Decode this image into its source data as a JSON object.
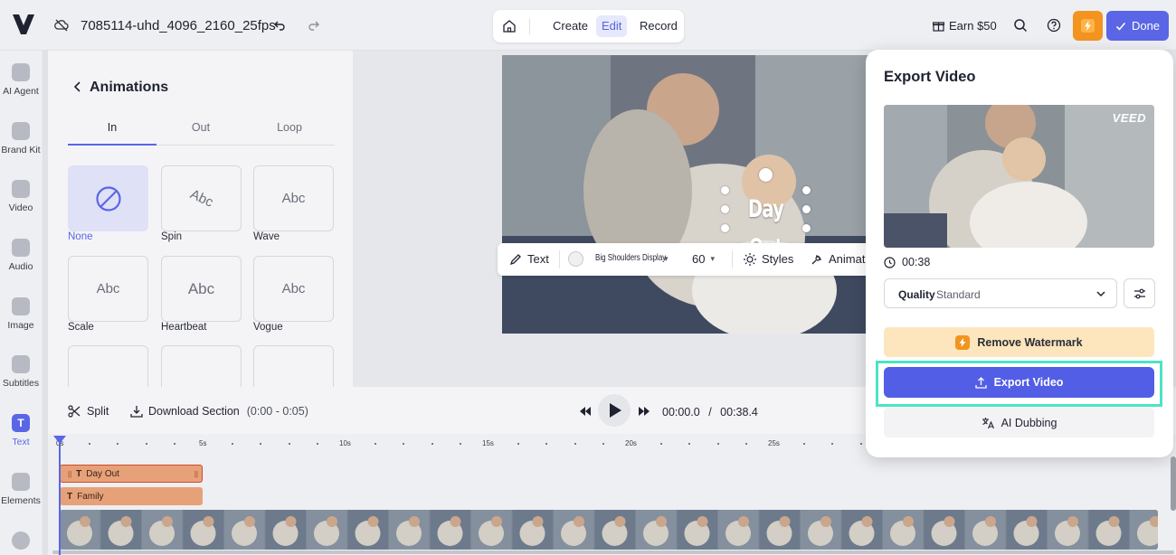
{
  "topbar": {
    "project_title": "7085114-uhd_4096_2160_25fps",
    "modes": {
      "create": "Create",
      "edit": "Edit",
      "record": "Record"
    },
    "earn_label": "Earn $50",
    "done_label": "Done",
    "icons": [
      "veed-logo-icon",
      "cloud-off-icon",
      "undo-icon",
      "redo-icon",
      "home-icon",
      "gift-icon",
      "search-icon",
      "help-icon",
      "bolt-icon",
      "check-icon"
    ]
  },
  "sidebar": {
    "items": [
      {
        "label": "AI Agent",
        "icon": "ai-agent-icon"
      },
      {
        "label": "Brand Kit",
        "icon": "brand-kit-icon"
      },
      {
        "label": "Video",
        "icon": "video-icon"
      },
      {
        "label": "Audio",
        "icon": "audio-icon"
      },
      {
        "label": "Image",
        "icon": "image-icon"
      },
      {
        "label": "Subtitles",
        "icon": "subtitles-icon"
      },
      {
        "label": "Text",
        "icon": "text-icon",
        "glyph": "T"
      },
      {
        "label": "Elements",
        "icon": "elements-icon"
      }
    ]
  },
  "animations_panel": {
    "title": "Animations",
    "tabs": [
      "In",
      "Out",
      "Loop"
    ],
    "active_tab": "In",
    "cards": [
      {
        "label": "None",
        "selected": true
      },
      {
        "label": "Spin",
        "preview": "Abc"
      },
      {
        "label": "Wave",
        "preview": "Abc"
      },
      {
        "label": "Scale",
        "preview": "Abc"
      },
      {
        "label": "Heartbeat",
        "preview": "Abc"
      },
      {
        "label": "Vogue",
        "preview": "Abc"
      }
    ]
  },
  "canvas": {
    "overlay_text": "Day Out",
    "toolbar": {
      "text_label": "Text",
      "font_name": "Big Shoulders Display",
      "font_size": "60",
      "styles_label": "Styles",
      "animation_label": "Animati"
    }
  },
  "timeline": {
    "split_label": "Split",
    "download_label": "Download Section",
    "download_range": "(0:00 - 0:05)",
    "current_time": "00:00.0",
    "time_separator": "/",
    "total_time": "00:38.4",
    "ruler_labels": [
      "0s",
      "5s",
      "10s",
      "15s",
      "20s",
      "25s"
    ],
    "clips": [
      {
        "label": "Day Out",
        "icon": "text-t-icon"
      },
      {
        "label": "Family",
        "icon": "text-t-icon"
      }
    ]
  },
  "export_modal": {
    "title": "Export Video",
    "watermark": "VEED",
    "duration": "00:38",
    "quality_label": "Quality",
    "quality_value": "Standard",
    "remove_watermark_label": "Remove Watermark",
    "export_button_label": "Export Video",
    "ai_dubbing_label": "AI Dubbing"
  },
  "colors": {
    "accent": "#5a66e6",
    "upgrade": "#f2941f",
    "highlight": "#4de3c5",
    "clip": "#e6a178"
  }
}
